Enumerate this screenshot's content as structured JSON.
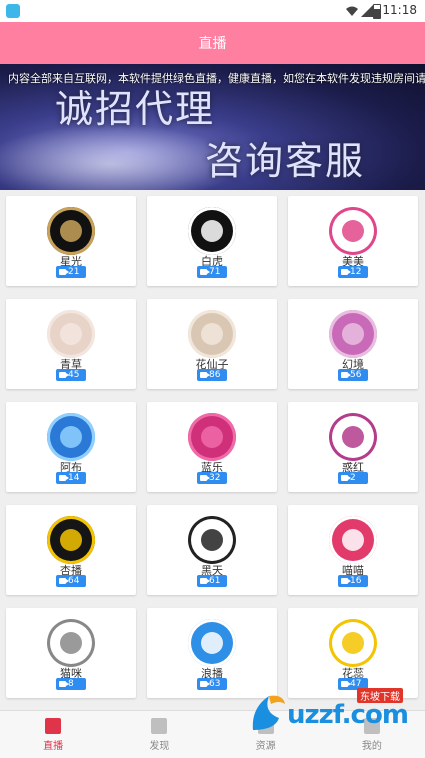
{
  "status": {
    "time": "11:18"
  },
  "appbar": {
    "title": "直播"
  },
  "banner": {
    "marquee": "内容全部来自互联网，本软件提供绿色直播，健康直播，如您在本软件发现违规房间请",
    "line1": "诚招代理",
    "line2": "咨询客服"
  },
  "cards": [
    {
      "name": "星光",
      "count": "21",
      "bg": "#111111",
      "ring": "#c9a25a"
    },
    {
      "name": "白虎",
      "count": "71",
      "bg": "#111111",
      "ring": "#ffffff"
    },
    {
      "name": "美美",
      "count": "12",
      "bg": "#ffffff",
      "ring": "#e0478a"
    },
    {
      "name": "青草",
      "count": "45",
      "bg": "#e8d3c8",
      "ring": "#f3e6df"
    },
    {
      "name": "花仙子",
      "count": "86",
      "bg": "#d9c7b3",
      "ring": "#f0e6da"
    },
    {
      "name": "幻境",
      "count": "56",
      "bg": "#c86ab8",
      "ring": "#e9bde0"
    },
    {
      "name": "阿布",
      "count": "14",
      "bg": "#2b79d6",
      "ring": "#8fd0ff"
    },
    {
      "name": "蓝乐",
      "count": "32",
      "bg": "#d0307a",
      "ring": "#f06aa8"
    },
    {
      "name": "惑红",
      "count": "2",
      "bg": "#ffffff",
      "ring": "#b33c8c"
    },
    {
      "name": "杏播",
      "count": "64",
      "bg": "#151515",
      "ring": "#f5c400"
    },
    {
      "name": "黑天",
      "count": "61",
      "bg": "#ffffff",
      "ring": "#222222"
    },
    {
      "name": "喵喵",
      "count": "16",
      "bg": "#e23a6a",
      "ring": "#ffffff"
    },
    {
      "name": "猫咪",
      "count": "8",
      "bg": "#ffffff",
      "ring": "#888888"
    },
    {
      "name": "浪播",
      "count": "63",
      "bg": "#2e8fe6",
      "ring": "#ffffff"
    },
    {
      "name": "花蕊",
      "count": "47",
      "bg": "#ffffff",
      "ring": "#f3c400"
    }
  ],
  "nav": [
    {
      "label": "直播",
      "icon": "live-icon",
      "active": true
    },
    {
      "label": "发现",
      "icon": "discover-icon",
      "active": false
    },
    {
      "label": "资源",
      "icon": "resource-icon",
      "active": false
    },
    {
      "label": "我的",
      "icon": "profile-icon",
      "active": false
    }
  ],
  "watermark": {
    "text": "uzzf.com",
    "sub": "东坡下载"
  }
}
